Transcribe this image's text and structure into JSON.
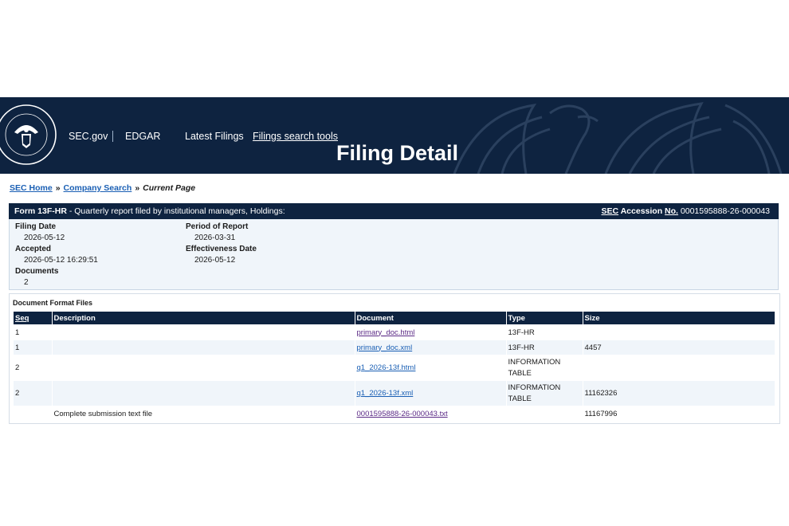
{
  "header": {
    "nav": [
      "SEC.gov",
      "EDGAR",
      "Latest Filings",
      "Filings search tools"
    ],
    "title": "Filing Detail",
    "seal_text": "SECURITIES AND EXCHANGE COMMISSION",
    "seal_year": "MCMXXXIV"
  },
  "breadcrumb": {
    "home": "SEC Home",
    "sep": "»",
    "company": "Company Search",
    "current": "Current Page"
  },
  "form": {
    "type": "Form 13F-HR",
    "description": " - Quarterly report filed by institutional managers, Holdings:",
    "accession_label_sec": "SEC",
    "accession_label_mid": " Accession ",
    "accession_label_no": "No.",
    "accession_number": " 0001595888-26-000043"
  },
  "info": {
    "filing_date_label": "Filing Date",
    "filing_date": "2026-05-12",
    "accepted_label": "Accepted",
    "accepted": "2026-05-12 16:29:51",
    "documents_label": "Documents",
    "documents": "2",
    "period_label": "Period of Report",
    "period": "2026-03-31",
    "effectiveness_label": "Effectiveness Date",
    "effectiveness": "2026-05-12"
  },
  "docs": {
    "section_title": "Document Format Files",
    "headers": [
      "Seq",
      "Description",
      "Document",
      "Type",
      "Size"
    ],
    "rows": [
      {
        "seq": "1",
        "description": "",
        "document": "primary_doc.html",
        "type": "13F-HR",
        "size": ""
      },
      {
        "seq": "1",
        "description": "",
        "document": "primary_doc.xml",
        "type": "13F-HR",
        "size": "4457"
      },
      {
        "seq": "2",
        "description": "",
        "document": "q1_2026-13f.html",
        "type": "INFORMATION TABLE",
        "size": ""
      },
      {
        "seq": "2",
        "description": "",
        "document": "q1_2026-13f.xml",
        "type": "INFORMATION TABLE",
        "size": "11162326"
      },
      {
        "seq": "",
        "description": "Complete submission text file",
        "document": "0001595888-26-000043.txt",
        "type": "",
        "size": "11167996"
      }
    ]
  }
}
